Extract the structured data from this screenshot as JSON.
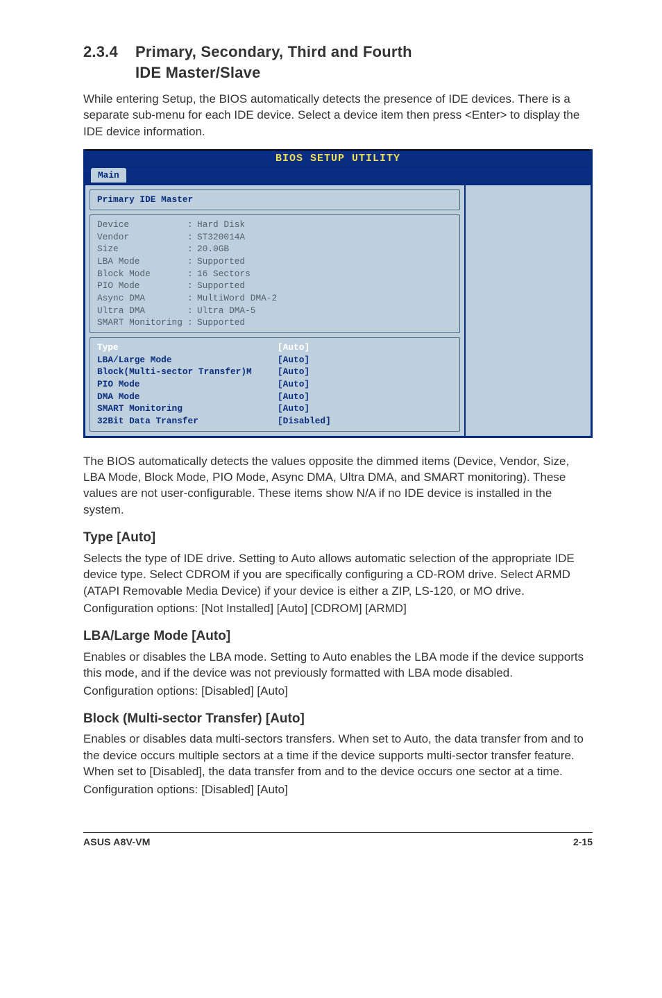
{
  "heading": {
    "number": "2.3.4",
    "title_line1": "Primary, Secondary, Third and Fourth",
    "title_line2": "IDE Master/Slave"
  },
  "intro": "While entering Setup, the BIOS automatically detects the presence of IDE devices. There is a separate sub-menu for each IDE device. Select a device item then press <Enter> to display the IDE device information.",
  "bios": {
    "utility_title": "BIOS SETUP UTILITY",
    "tab": "Main",
    "panel_title": "Primary IDE Master",
    "readonly": [
      {
        "k": "Device",
        "v": "Hard Disk"
      },
      {
        "k": "Vendor",
        "v": "ST320014A"
      },
      {
        "k": "Size",
        "v": "20.0GB"
      },
      {
        "k": "LBA Mode",
        "v": "Supported"
      },
      {
        "k": "Block Mode",
        "v": "16 Sectors"
      },
      {
        "k": "PIO Mode",
        "v": "Supported"
      },
      {
        "k": "Async DMA",
        "v": "MultiWord DMA-2"
      },
      {
        "k": "Ultra DMA",
        "v": "Ultra DMA-5"
      },
      {
        "k": "SMART Monitoring",
        "v": "Supported"
      }
    ],
    "editable": [
      {
        "label": "Type",
        "val": "[Auto]",
        "hl": true
      },
      {
        "label": "LBA/Large Mode",
        "val": "[Auto]",
        "hl": false
      },
      {
        "label": "Block(Multi-sector Transfer)M",
        "val": "[Auto]",
        "hl": false
      },
      {
        "label": "PIO Mode",
        "val": "[Auto]",
        "hl": false
      },
      {
        "label": "DMA Mode",
        "val": "[Auto]",
        "hl": false
      },
      {
        "label": "SMART Monitoring",
        "val": "[Auto]",
        "hl": false
      },
      {
        "label": "32Bit Data Transfer",
        "val": "[Disabled]",
        "hl": false
      }
    ]
  },
  "post_bios": "The BIOS automatically detects the values opposite the dimmed items (Device, Vendor, Size, LBA Mode, Block Mode, PIO Mode, Async DMA, Ultra DMA, and SMART monitoring). These values are not user-configurable. These items show N/A if no IDE device is installed in the system.",
  "sections": [
    {
      "title": "Type [Auto]",
      "body": "Selects the type of IDE drive. Setting to Auto allows automatic selection of the appropriate IDE device type. Select CDROM if you are specifically configuring a CD-ROM drive. Select ARMD (ATAPI Removable Media Device) if your device is either a ZIP, LS-120, or MO drive.",
      "opts": "Configuration options: [Not Installed] [Auto] [CDROM] [ARMD]"
    },
    {
      "title": "LBA/Large Mode [Auto]",
      "body": "Enables or disables the LBA mode. Setting to Auto enables the LBA mode if the device supports this mode, and if the device was not previously formatted with LBA mode disabled.",
      "opts": "Configuration options: [Disabled] [Auto]"
    },
    {
      "title": "Block (Multi-sector Transfer) [Auto]",
      "body": "Enables or disables data multi-sectors transfers. When set to Auto, the data transfer from and to the device occurs multiple sectors at a time if the device supports multi-sector transfer feature. When set to [Disabled], the data transfer from and to the device occurs one sector at a time.",
      "opts": "Configuration options: [Disabled] [Auto]"
    }
  ],
  "footer": {
    "product": "ASUS A8V-VM",
    "page": "2-15"
  }
}
